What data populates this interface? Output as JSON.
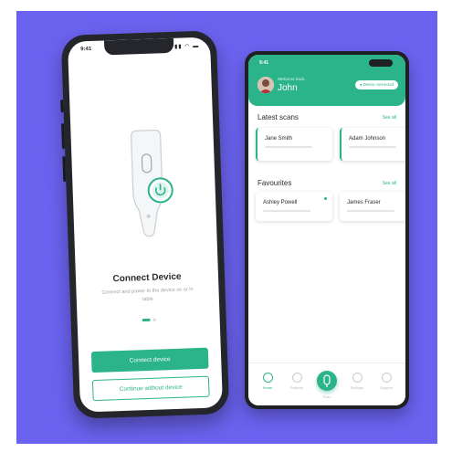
{
  "colors": {
    "background": "#6b63f0",
    "accent": "#2bb38a",
    "phone_frame": "#25262b"
  },
  "left_phone": {
    "status_time": "9:41",
    "status_icons": "▮▮ ◠ ▬",
    "title": "Connect Device",
    "description": "Connect and power to the device on or in table",
    "primary_button": "Connect device",
    "secondary_button": "Continue without device",
    "pager": {
      "count": 2,
      "active": 0
    }
  },
  "right_phone": {
    "status_time": "9:41",
    "welcome": "Welcome back,",
    "user_name": "John",
    "device_pill": "● Device connected",
    "latest_scans": {
      "title": "Latest scans",
      "see_all": "See all",
      "items": [
        "Jane Smith",
        "Adam Johnson"
      ]
    },
    "favourites": {
      "title": "Favourites",
      "see_all": "See all",
      "items": [
        "Ashley Powell",
        "James Fraser"
      ]
    },
    "nav": [
      {
        "label": "Home",
        "icon": "home-icon",
        "active": true
      },
      {
        "label": "Patients",
        "icon": "folder-icon",
        "active": false
      },
      {
        "label": "Scan",
        "icon": "scan-device-icon",
        "active": false
      },
      {
        "label": "Settings",
        "icon": "gear-icon",
        "active": false
      },
      {
        "label": "Support",
        "icon": "help-icon",
        "active": false
      }
    ]
  }
}
